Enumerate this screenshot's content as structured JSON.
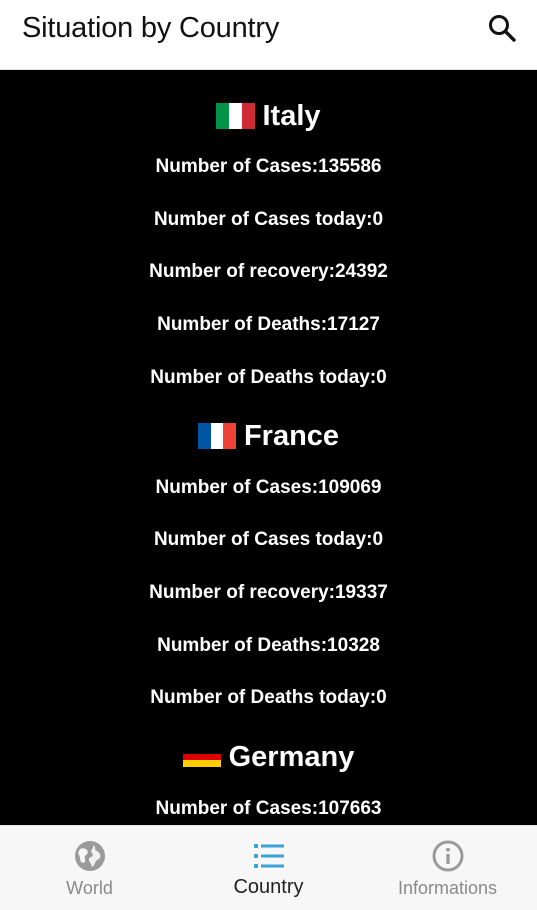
{
  "appbar": {
    "title": "Situation by Country",
    "search_icon": "search-icon"
  },
  "colors": {
    "appbar_bg": "#ffffff",
    "content_bg": "#000000",
    "text": "#ffffff",
    "nav_active": "#3aa3d8",
    "nav_inactive": "#9a9a9a"
  },
  "countries": [
    {
      "name": "Italy",
      "flag_colors": [
        "#009246",
        "#ffffff",
        "#ce2b37"
      ],
      "stats": [
        "Number of Cases:135586",
        "Number of Cases today:0",
        "Number of recovery:24392",
        "Number of Deaths:17127",
        "Number of Deaths today:0"
      ]
    },
    {
      "name": "France",
      "flag_colors": [
        "#0055a4",
        "#ffffff",
        "#ef4135"
      ],
      "stats": [
        "Number of Cases:109069",
        "Number of Cases today:0",
        "Number of recovery:19337",
        "Number of Deaths:10328",
        "Number of Deaths today:0"
      ]
    },
    {
      "name": "Germany",
      "flag_colors": [
        "#000000",
        "#dd0000",
        "#ffce00"
      ],
      "stats": [
        "Number of Cases:107663"
      ]
    }
  ],
  "bottom_nav": {
    "items": [
      {
        "label": "World",
        "icon": "globe-icon",
        "active": false
      },
      {
        "label": "Country",
        "icon": "list-icon",
        "active": true
      },
      {
        "label": "Informations",
        "icon": "info-icon",
        "active": false
      }
    ]
  }
}
